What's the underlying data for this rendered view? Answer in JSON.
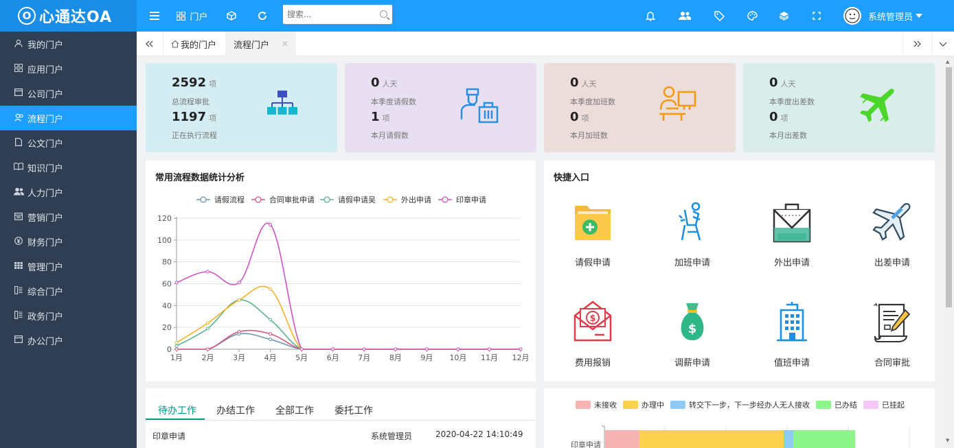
{
  "app": {
    "logo_mark": "O",
    "logo_text": "心通达OA"
  },
  "topbar": {
    "portal_label": "门户",
    "search_placeholder": "搜索...",
    "user_name": "系统管理员"
  },
  "sidebar": {
    "items": [
      {
        "label": "我的门户",
        "icon": "user-icon"
      },
      {
        "label": "应用门户",
        "icon": "apps-icon"
      },
      {
        "label": "公司门户",
        "icon": "window-icon"
      },
      {
        "label": "流程门户",
        "icon": "flow-icon",
        "active": true
      },
      {
        "label": "公文门户",
        "icon": "document-icon"
      },
      {
        "label": "知识门户",
        "icon": "book-icon"
      },
      {
        "label": "人力门户",
        "icon": "people-icon"
      },
      {
        "label": "营销门户",
        "icon": "calendar-icon"
      },
      {
        "label": "财务门户",
        "icon": "yen-icon"
      },
      {
        "label": "管理门户",
        "icon": "grid-icon"
      },
      {
        "label": "综合门户",
        "icon": "columns-icon"
      },
      {
        "label": "政务门户",
        "icon": "columns-icon"
      },
      {
        "label": "办公门户",
        "icon": "window-icon"
      }
    ]
  },
  "tabs": {
    "home": "我的门户",
    "current": "流程门户"
  },
  "cards": [
    {
      "v1": "2592",
      "u1": "项",
      "l1": "总流程审批",
      "v2": "1197",
      "u2": "项",
      "l2": "正在执行流程",
      "bg": "#d3edf2"
    },
    {
      "v1": "0",
      "u1": "人天",
      "l1": "本季度请假数",
      "v2": "1",
      "u2": "项",
      "l2": "本月请假数",
      "bg": "#e8e0f2"
    },
    {
      "v1": "0",
      "u1": "人天",
      "l1": "本季度加班数",
      "v2": "0",
      "u2": "项",
      "l2": "本月加班数",
      "bg": "#ecdcda"
    },
    {
      "v1": "0",
      "u1": "人天",
      "l1": "本季度出差数",
      "v2": "0",
      "u2": "项",
      "l2": "本月出差数",
      "bg": "#d9eeea"
    }
  ],
  "chart_panel": {
    "title": "常用流程数据统计分析"
  },
  "chart_data": {
    "type": "line",
    "x": [
      "1月",
      "2月",
      "3月",
      "4月",
      "5月",
      "6月",
      "7月",
      "8月",
      "9月",
      "10月",
      "11月",
      "12月"
    ],
    "ylim": [
      0,
      120
    ],
    "yticks": [
      "0",
      "20",
      "40",
      "60",
      "80",
      "100",
      "120"
    ],
    "series": [
      {
        "name": "请假流程",
        "color": "#6a95b5",
        "values": [
          0,
          0,
          14,
          9,
          0,
          0,
          0,
          0,
          0,
          0,
          0,
          0
        ]
      },
      {
        "name": "合同审批申请",
        "color": "#d6587e",
        "values": [
          0,
          0,
          16,
          14,
          0,
          0,
          0,
          0,
          0,
          0,
          0,
          0
        ]
      },
      {
        "name": "请假申请吴",
        "color": "#57b389",
        "values": [
          3,
          19,
          45,
          27,
          0,
          0,
          0,
          0,
          0,
          0,
          0,
          0
        ]
      },
      {
        "name": "外出申请",
        "color": "#f5b326",
        "values": [
          6,
          24,
          45,
          55,
          0,
          0,
          0,
          0,
          0,
          0,
          0,
          0
        ]
      },
      {
        "name": "印章申请",
        "color": "#d252c9",
        "values": [
          61,
          71,
          61,
          114,
          0,
          0,
          0,
          0,
          0,
          0,
          0,
          0
        ]
      }
    ]
  },
  "quick": {
    "title": "快捷入口",
    "items": [
      {
        "label": "请假申请",
        "icon": "folder-add-icon"
      },
      {
        "label": "加班申请",
        "icon": "overtime-icon"
      },
      {
        "label": "外出申请",
        "icon": "bag-icon"
      },
      {
        "label": "出差申请",
        "icon": "airplane-icon"
      },
      {
        "label": "费用报销",
        "icon": "envelope-money-icon"
      },
      {
        "label": "调薪申请",
        "icon": "money-bag-icon"
      },
      {
        "label": "值班申请",
        "icon": "building-icon"
      },
      {
        "label": "合同审批",
        "icon": "contract-icon"
      }
    ]
  },
  "work": {
    "tabs": [
      "待办工作",
      "办结工作",
      "全部工作",
      "委托工作"
    ],
    "rows": [
      {
        "name": "印章申请",
        "user": "系统管理员",
        "time": "2020-04-22 14:10:49"
      }
    ]
  },
  "status_chart": {
    "legend": [
      {
        "name": "未接收",
        "color": "#f7b3b3"
      },
      {
        "name": "办理中",
        "color": "#fbd24e"
      },
      {
        "name": "转交下一步，下一步经办人无人接收",
        "color": "#8fcaf5"
      },
      {
        "name": "已办结",
        "color": "#8ef58c"
      },
      {
        "name": "已挂起",
        "color": "#f3c7f7"
      }
    ],
    "row_label": "印章申请",
    "segments": [
      50,
      210,
      14,
      90
    ]
  }
}
